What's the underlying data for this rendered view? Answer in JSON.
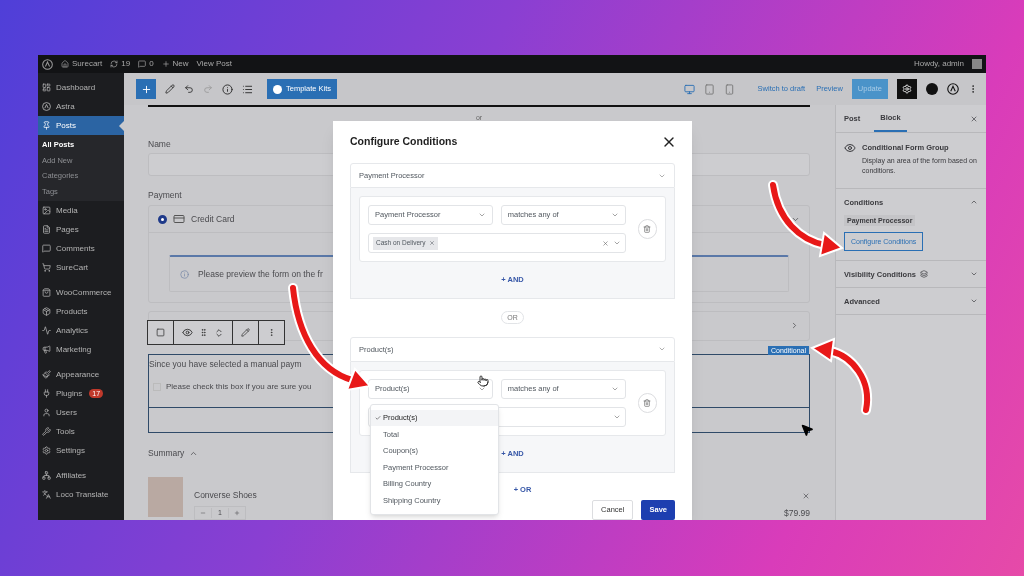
{
  "admin_bar": {
    "site": "Surecart",
    "updates": "19",
    "comments": "0",
    "new": "New",
    "view_post": "View Post",
    "greeting": "Howdy, admin"
  },
  "sidebar": {
    "items": [
      {
        "label": "Dashboard",
        "selected": false
      },
      {
        "label": "Astra",
        "selected": false
      },
      {
        "label": "Posts",
        "selected": true,
        "children": [
          {
            "label": "All Posts",
            "selected": true
          },
          {
            "label": "Add New",
            "selected": false
          },
          {
            "label": "Categories",
            "selected": false
          },
          {
            "label": "Tags",
            "selected": false
          }
        ]
      },
      {
        "label": "Media",
        "selected": false
      },
      {
        "label": "Pages",
        "selected": false
      },
      {
        "label": "Comments",
        "selected": false
      },
      {
        "label": "SureCart",
        "selected": false
      },
      {
        "label": "WooCommerce",
        "selected": false
      },
      {
        "label": "Products",
        "selected": false
      },
      {
        "label": "Analytics",
        "selected": false
      },
      {
        "label": "Marketing",
        "selected": false
      },
      {
        "label": "Appearance",
        "selected": false
      },
      {
        "label": "Plugins",
        "selected": false,
        "badge": "17"
      },
      {
        "label": "Users",
        "selected": false
      },
      {
        "label": "Tools",
        "selected": false
      },
      {
        "label": "Settings",
        "selected": false
      },
      {
        "label": "Affiliates",
        "selected": false
      },
      {
        "label": "Loco Translate",
        "selected": false
      }
    ]
  },
  "toolbar": {
    "template_kits": "Template Kits",
    "devices": [
      {
        "selected": true
      },
      {
        "selected": false
      },
      {
        "selected": false
      }
    ],
    "switch_to_draft": "Switch to draft",
    "preview": "Preview",
    "update": {
      "label": "Update",
      "disabled": true
    },
    "settings_active": true
  },
  "canvas": {
    "separator": "or",
    "name_label": "Name",
    "payment_label": "Payment",
    "payment_option": {
      "label": "Credit Card",
      "selected": true
    },
    "notice": "Please preview the form on the fr",
    "group_badge": "Conditional",
    "group_text": "Since you have selected a manual paym",
    "checkbox": {
      "label": "Please check this box if you are sure you",
      "checked": false
    },
    "summary": "Summary",
    "product": {
      "name": "Converse Shoes",
      "quantity": "1",
      "price": "$79.99"
    }
  },
  "settings_panel": {
    "tabs": [
      {
        "label": "Post",
        "selected": false
      },
      {
        "label": "Block",
        "selected": true
      }
    ],
    "block": {
      "title": "Conditional Form Group",
      "description": "Display an area of the form based on conditions."
    },
    "sections": [
      {
        "title": "Conditions",
        "expanded": true,
        "chip": "Payment Processor",
        "button": "Configure Conditions"
      },
      {
        "title": "Visibility Conditions",
        "expanded": false
      },
      {
        "title": "Advanced",
        "expanded": false
      }
    ]
  },
  "dialog": {
    "title": "Configure Conditions",
    "groups": [
      {
        "header": "Payment Processor",
        "rule": {
          "field": "Payment Processor",
          "operator": "matches any of",
          "values": [
            "Cash on Delivery"
          ]
        },
        "add_and": "+ AND"
      },
      {
        "header": "Product(s)",
        "rule": {
          "field": "Product(s)",
          "operator": "matches any of",
          "options": [
            {
              "label": "Product(s)",
              "selected": true
            },
            {
              "label": "Total",
              "selected": false
            },
            {
              "label": "Coupon(s)",
              "selected": false
            },
            {
              "label": "Payment Processor",
              "selected": false
            },
            {
              "label": "Billing Country",
              "selected": false
            },
            {
              "label": "Shipping Country",
              "selected": false
            }
          ]
        },
        "add_and": "+ AND"
      }
    ],
    "separator": "OR",
    "add_or": "+ OR",
    "cancel": "Cancel",
    "save": "Save"
  }
}
